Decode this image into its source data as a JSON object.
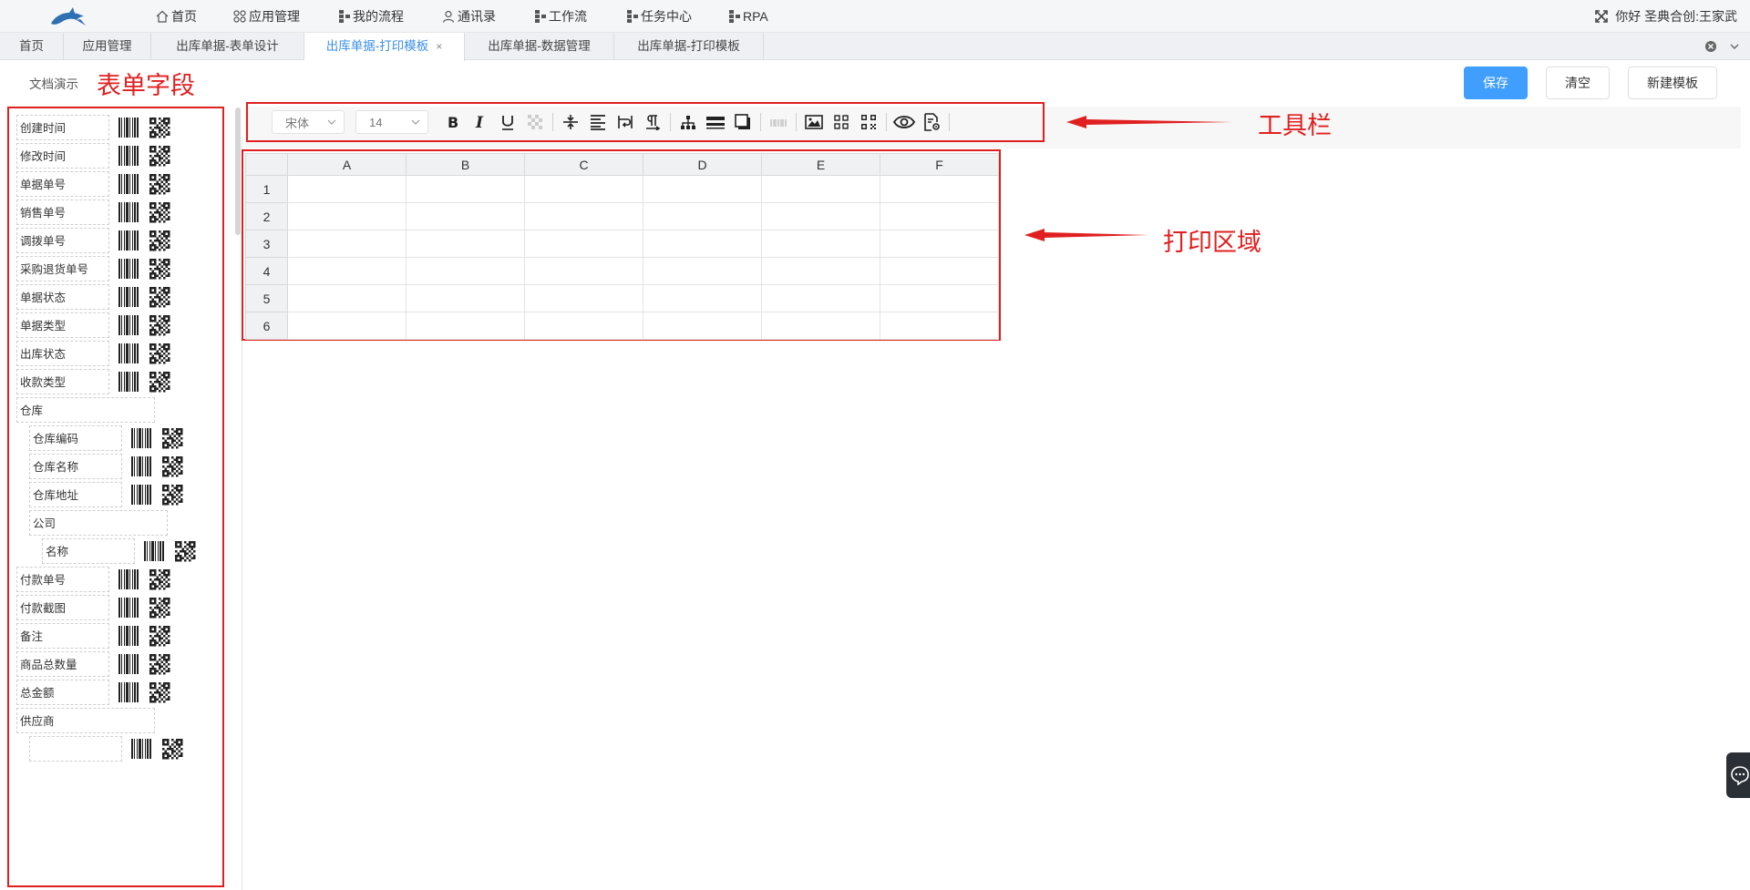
{
  "topnav": {
    "items": [
      {
        "label": "首页",
        "icon": "home-icon"
      },
      {
        "label": "应用管理",
        "icon": "apps-icon"
      },
      {
        "label": "我的流程",
        "icon": "flow-icon"
      },
      {
        "label": "通讯录",
        "icon": "user-icon"
      },
      {
        "label": "工作流",
        "icon": "flow-icon"
      },
      {
        "label": "任务中心",
        "icon": "flow-icon"
      },
      {
        "label": "RPA",
        "icon": "flow-icon"
      }
    ],
    "greeting": "你好 圣典合创:王家武"
  },
  "tabs": [
    {
      "label": "首页",
      "active": false
    },
    {
      "label": "应用管理",
      "active": false
    },
    {
      "label": "出库单据-表单设计",
      "active": false
    },
    {
      "label": "出库单据-打印模板",
      "active": true,
      "close": "×"
    },
    {
      "label": "出库单据-数据管理",
      "active": false
    },
    {
      "label": "出库单据-打印模板",
      "active": false
    }
  ],
  "header": {
    "doc_label": "文档演示",
    "save": "保存",
    "clear": "清空",
    "new_template": "新建模板"
  },
  "annotations": {
    "form_fields": "表单字段",
    "toolbar": "工具栏",
    "print_area": "打印区域",
    "color": "#e02020"
  },
  "fields": [
    {
      "label": "创建时间",
      "level": 0,
      "type": "field"
    },
    {
      "label": "修改时间",
      "level": 0,
      "type": "field"
    },
    {
      "label": "单据单号",
      "level": 0,
      "type": "field"
    },
    {
      "label": "销售单号",
      "level": 0,
      "type": "field"
    },
    {
      "label": "调拨单号",
      "level": 0,
      "type": "field"
    },
    {
      "label": "采购退货单号",
      "level": 0,
      "type": "field"
    },
    {
      "label": "单据状态",
      "level": 0,
      "type": "field"
    },
    {
      "label": "单据类型",
      "level": 0,
      "type": "field"
    },
    {
      "label": "出库状态",
      "level": 0,
      "type": "field"
    },
    {
      "label": "收款类型",
      "level": 0,
      "type": "field"
    },
    {
      "label": "仓库",
      "level": 0,
      "type": "group"
    },
    {
      "label": "仓库编码",
      "level": 1,
      "type": "field"
    },
    {
      "label": "仓库名称",
      "level": 1,
      "type": "field"
    },
    {
      "label": "仓库地址",
      "level": 1,
      "type": "field"
    },
    {
      "label": "公司",
      "level": 1,
      "type": "group"
    },
    {
      "label": "名称",
      "level": 2,
      "type": "field"
    },
    {
      "label": "付款单号",
      "level": 0,
      "type": "field"
    },
    {
      "label": "付款截图",
      "level": 0,
      "type": "field"
    },
    {
      "label": "备注",
      "level": 0,
      "type": "field"
    },
    {
      "label": "商品总数量",
      "level": 0,
      "type": "field"
    },
    {
      "label": "总金额",
      "level": 0,
      "type": "field"
    },
    {
      "label": "供应商",
      "level": 0,
      "type": "group"
    }
  ],
  "toolbar": {
    "font_family": "宋体",
    "font_size": "14",
    "buttons": [
      "bold-icon",
      "italic-icon",
      "underline-icon",
      "clear-format-icon",
      "valign-icon",
      "align-left-icon",
      "wrap-text-icon",
      "paragraph-icon",
      "tree-icon",
      "border-icon",
      "shadow-icon",
      "barcode-placeholder-icon",
      "image-icon",
      "grid-icon",
      "qrcode-icon",
      "preview-icon",
      "settings-doc-icon"
    ]
  },
  "grid": {
    "columns": [
      "A",
      "B",
      "C",
      "D",
      "E",
      "F"
    ],
    "rows": [
      "1",
      "2",
      "3",
      "4",
      "5",
      "6"
    ]
  },
  "accent": "#409eff"
}
